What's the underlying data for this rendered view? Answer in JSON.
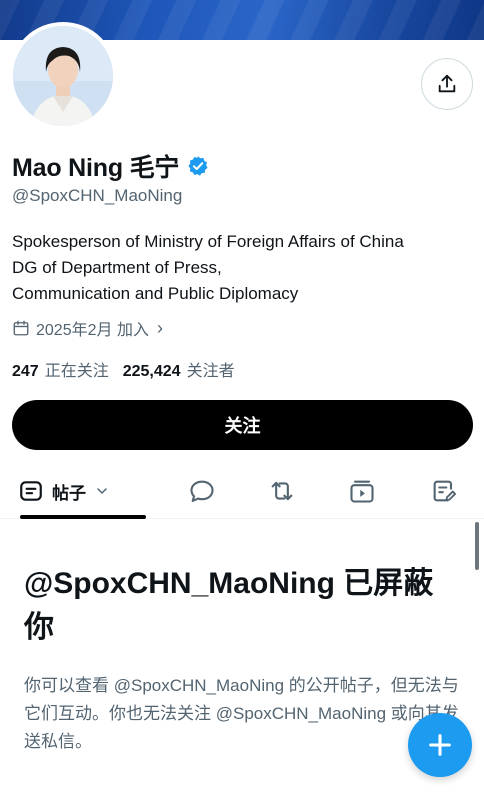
{
  "profile": {
    "display_name": "Mao Ning 毛宁",
    "handle": "@SpoxCHN_MaoNing",
    "bio_lines": [
      "Spokesperson of Ministry of Foreign Affairs of China",
      "DG of Department of Press,",
      "Communication and Public Diplomacy"
    ],
    "joined": "2025年2月 加入",
    "following_count": "247",
    "following_label": "正在关注",
    "followers_count": "225,424",
    "followers_label": "关注者",
    "verified_color": "#1d9bf0"
  },
  "actions": {
    "follow_label": "关注"
  },
  "tabs": {
    "posts_label": "帖子"
  },
  "blocked": {
    "title": "@SpoxCHN_MaoNing 已屏蔽你",
    "description": "你可以查看 @SpoxCHN_MaoNing 的公开帖子，但无法与它们互动。你也无法关注 @SpoxCHN_MaoNing 或向其发送私信。"
  },
  "colors": {
    "accent": "#1d9bf0",
    "banner": "#1e56b8",
    "text_primary": "#0f1419",
    "text_secondary": "#536471"
  },
  "icons": [
    "share-icon",
    "verified-badge-icon",
    "calendar-icon",
    "chevron-right-icon",
    "posts-icon",
    "chevron-down-icon",
    "reply-icon",
    "repost-icon",
    "media-icon",
    "articles-icon",
    "compose-plus-icon"
  ]
}
